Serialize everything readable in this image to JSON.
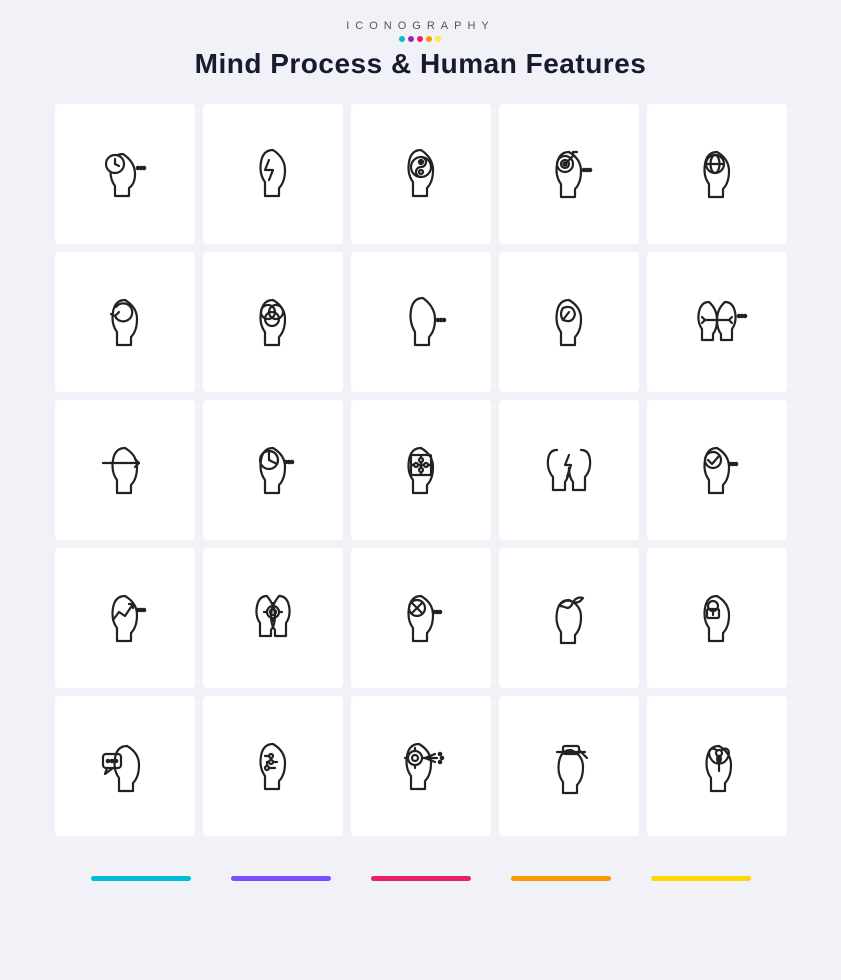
{
  "header": {
    "brand": "ICONOGRAPHY",
    "title": "Mind Process & Human Features",
    "dots": [
      {
        "color": "#00bcd4"
      },
      {
        "color": "#9c27b0"
      },
      {
        "color": "#e91e63"
      },
      {
        "color": "#ff9800"
      },
      {
        "color": "#ffeb3b"
      }
    ]
  },
  "footer_bars": [
    {
      "color": "#00bcd4"
    },
    {
      "color": "#7c4dff"
    },
    {
      "color": "#e91e63"
    },
    {
      "color": "#ff9800"
    },
    {
      "color": "#ffd600"
    }
  ],
  "icons": [
    {
      "id": "icon-1",
      "label": "time mind"
    },
    {
      "id": "icon-2",
      "label": "thunder brain"
    },
    {
      "id": "icon-3",
      "label": "yin yang mind"
    },
    {
      "id": "icon-4",
      "label": "target mind"
    },
    {
      "id": "icon-5",
      "label": "global mind"
    },
    {
      "id": "icon-6",
      "label": "refresh mind"
    },
    {
      "id": "icon-7",
      "label": "circles mind"
    },
    {
      "id": "icon-8",
      "label": "side face"
    },
    {
      "id": "icon-9",
      "label": "nature leaf mind"
    },
    {
      "id": "icon-10",
      "label": "compare minds"
    },
    {
      "id": "icon-11",
      "label": "arrow mind"
    },
    {
      "id": "icon-12",
      "label": "pie chart mind"
    },
    {
      "id": "icon-13",
      "label": "puzzle mind"
    },
    {
      "id": "icon-14",
      "label": "thunder heart mind"
    },
    {
      "id": "icon-15",
      "label": "check mind"
    },
    {
      "id": "icon-16",
      "label": "growth mind"
    },
    {
      "id": "icon-17",
      "label": "gear mind"
    },
    {
      "id": "icon-18",
      "label": "cancel mind"
    },
    {
      "id": "icon-19",
      "label": "bird free mind"
    },
    {
      "id": "icon-20",
      "label": "lock mind"
    },
    {
      "id": "icon-21",
      "label": "speech mind"
    },
    {
      "id": "icon-22",
      "label": "circuit mind"
    },
    {
      "id": "icon-23",
      "label": "gear process mind"
    },
    {
      "id": "icon-24",
      "label": "hat mind"
    },
    {
      "id": "icon-25",
      "label": "flower mind"
    }
  ]
}
